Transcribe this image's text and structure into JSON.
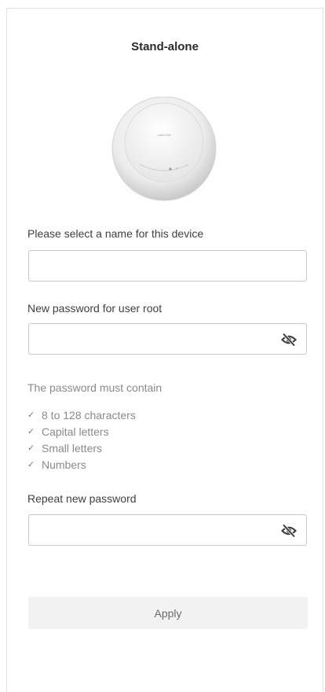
{
  "page": {
    "title": "Stand-alone"
  },
  "device_image": {
    "brand_text": "LANCOM",
    "icon": "access-point-image"
  },
  "form": {
    "device_name": {
      "label": "Please select a name for this device",
      "value": "",
      "placeholder": ""
    },
    "new_password": {
      "label": "New password for user root",
      "value": "",
      "placeholder": "",
      "visibility_icon": "eye-slash-icon"
    },
    "password_requirements": {
      "heading": "The password must contain",
      "items": [
        "8 to 128 characters",
        "Capital letters",
        "Small letters",
        "Numbers"
      ],
      "check_icon": "checkmark-icon"
    },
    "repeat_password": {
      "label": "Repeat new password",
      "value": "",
      "placeholder": "",
      "visibility_icon": "eye-slash-icon"
    },
    "apply_label": "Apply"
  }
}
